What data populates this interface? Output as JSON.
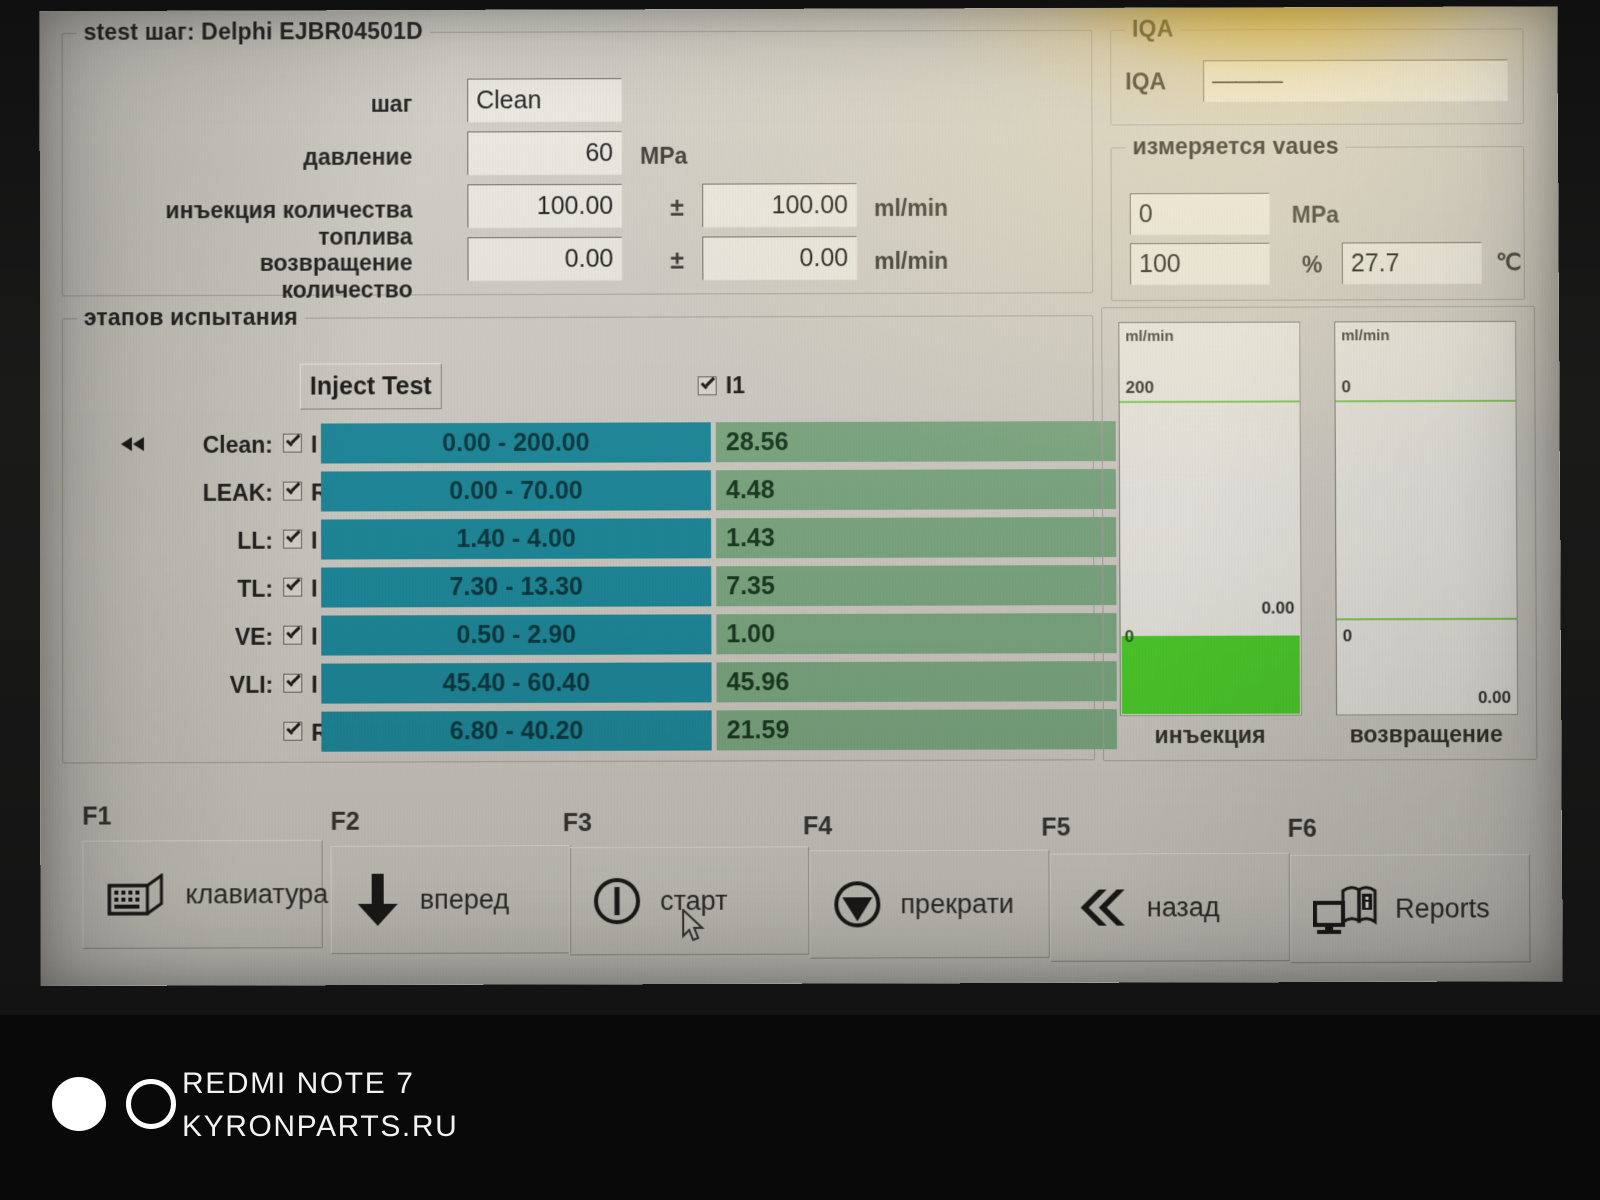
{
  "window": {
    "title": "stest шаг: Delphi EJBR04501D"
  },
  "params": {
    "step_label": "шаг",
    "step_value": "Clean",
    "pressure_label": "давление",
    "pressure_value": "60",
    "pressure_unit": "MPa",
    "injection_label": "инъекция количества топлива",
    "injection_value": "100.00",
    "injection_tol": "100.00",
    "injection_unit": "ml/min",
    "return_label": "возвращение количество",
    "return_value": "0.00",
    "return_tol": "0.00",
    "return_unit": "ml/min",
    "plusminus": "±"
  },
  "stages": {
    "legend": "этапов испытания",
    "inject_test_button": "Inject Test",
    "column_checkbox_label": "I1",
    "rows": [
      {
        "name": "Clean:",
        "side": "I",
        "range": "0.00 - 200.00",
        "value": "28.56",
        "active": true
      },
      {
        "name": "LEAK:",
        "side": "R",
        "range": "0.00 - 70.00",
        "value": "4.48",
        "active": false
      },
      {
        "name": "LL:",
        "side": "I",
        "range": "1.40 - 4.00",
        "value": "1.43",
        "active": false
      },
      {
        "name": "TL:",
        "side": "I",
        "range": "7.30 - 13.30",
        "value": "7.35",
        "active": false
      },
      {
        "name": "VE:",
        "side": "I",
        "range": "0.50 - 2.90",
        "value": "1.00",
        "active": false
      },
      {
        "name": "VLI:",
        "side": "I",
        "range": "45.40 - 60.40",
        "value": "45.96",
        "active": false
      },
      {
        "name": "",
        "side": "R",
        "range": "6.80 - 40.20",
        "value": "21.59",
        "active": false
      }
    ]
  },
  "iqa": {
    "legend": "IQA",
    "field_label": "IQA",
    "field_value": "———"
  },
  "measured": {
    "legend": "измеряется vaues",
    "pressure_value": "0",
    "pressure_unit": "MPa",
    "percent_value": "100",
    "percent_unit": "%",
    "temp_value": "27.7",
    "temp_unit": "℃"
  },
  "chart_data": [
    {
      "type": "bar",
      "title": "инъекция",
      "ylabel": "ml/min",
      "ticks": [
        {
          "label": "200",
          "value": 200
        },
        {
          "label": "0",
          "value": 0
        }
      ],
      "value_label": "0.00",
      "value": 0.0,
      "fill_color": "#4fd12c",
      "tick_color": "#7fcf57"
    },
    {
      "type": "bar",
      "title": "возвращение",
      "ylabel": "ml/min",
      "ticks": [
        {
          "label": "0",
          "value": 0
        },
        {
          "label": "0",
          "value": 0
        }
      ],
      "value_label": "0.00",
      "value": 0.0,
      "fill_color": "#4fd12c",
      "tick_color": "#7fcf57"
    }
  ],
  "function_keys": [
    {
      "key": "F1",
      "label": "клавиатура",
      "icon": "keyboard-icon"
    },
    {
      "key": "F2",
      "label": "вперед",
      "icon": "arrow-down-icon"
    },
    {
      "key": "F3",
      "label": "старт",
      "icon": "power-icon"
    },
    {
      "key": "F4",
      "label": "прекрати",
      "icon": "stop-icon"
    },
    {
      "key": "F5",
      "label": "назад",
      "icon": "chevron-double-left-icon"
    },
    {
      "key": "F6",
      "label": "Reports",
      "icon": "monitor-book-icon"
    }
  ],
  "watermark": {
    "line1": "REDMI NOTE 7",
    "line2": "KYRONPARTS.RU"
  },
  "colors": {
    "range_bar": "#1f8c9e",
    "value_bar": "#7fab84",
    "gauge_fill": "#4fd12c",
    "panel": "#d2cfc7"
  }
}
